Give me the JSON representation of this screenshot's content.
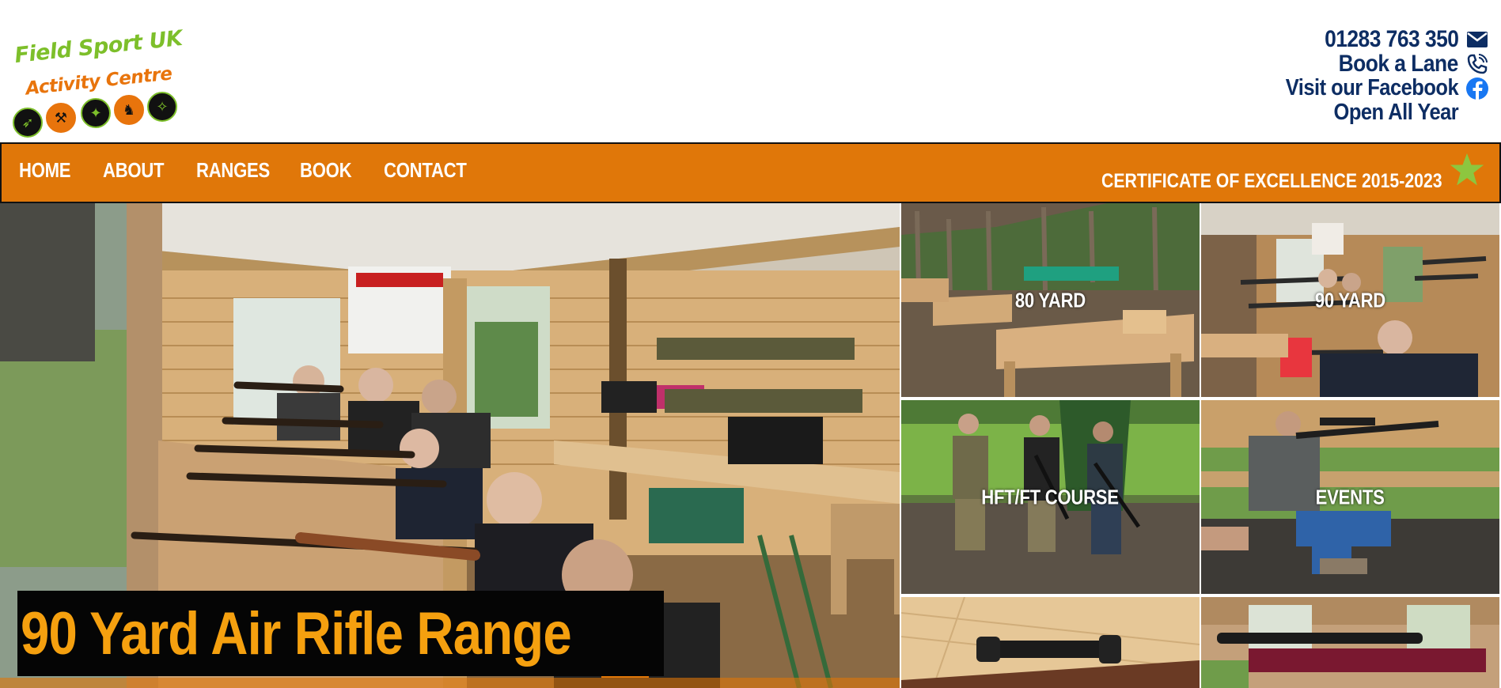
{
  "logo": {
    "line1": "Field Sport UK",
    "line2": "Activity Centre",
    "icons": [
      "archery-icon",
      "axe-throwing-icon",
      "shooting-icon",
      "knife-throwing-icon",
      "rifle-icon"
    ]
  },
  "contact": {
    "phone": "01283 763 350",
    "book": "Book a Lane",
    "facebook": "Visit our Facebook",
    "open": "Open All Year",
    "icons": [
      "mail-icon",
      "phone-icon",
      "facebook-icon"
    ]
  },
  "nav": {
    "items": [
      "HOME",
      "ABOUT",
      "RANGES",
      "BOOK",
      "CONTACT"
    ],
    "certificate": "CERTIFICATE OF EXCELLENCE 2015-2023"
  },
  "hero": {
    "title": "90 Yard Air Rifle Range"
  },
  "tiles": [
    {
      "label": "80 YARD"
    },
    {
      "label": "90 YARD"
    },
    {
      "label": "HFT/FT COURSE"
    },
    {
      "label": "EVENTS"
    },
    {
      "label": ""
    },
    {
      "label": ""
    }
  ],
  "colors": {
    "nav_bg": "#e07709",
    "contact_text": "#0d2d63",
    "hero_title": "#f5a00f",
    "logo_green": "#7dbf2a",
    "logo_orange": "#e8740c"
  }
}
